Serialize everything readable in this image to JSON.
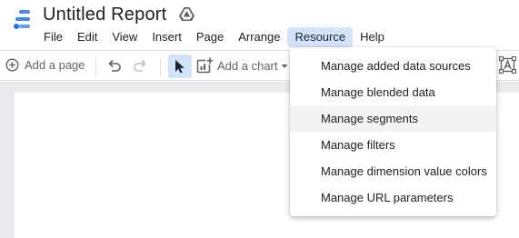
{
  "app": {
    "title": "Untitled Report"
  },
  "menubar": {
    "items": [
      "File",
      "Edit",
      "View",
      "Insert",
      "Page",
      "Arrange",
      "Resource",
      "Help"
    ],
    "active": "Resource"
  },
  "toolbar": {
    "add_page_label": "Add a page",
    "add_chart_label": "Add a chart"
  },
  "resource_menu": {
    "items": [
      "Manage added data sources",
      "Manage blended data",
      "Manage segments",
      "Manage filters",
      "Manage dimension value colors",
      "Manage URL parameters"
    ],
    "highlighted_index": 2
  },
  "colors": {
    "accent_blue": "#4285f4",
    "active_menu_bg": "#d3e3fd",
    "canvas_bg": "#e8eaed"
  }
}
